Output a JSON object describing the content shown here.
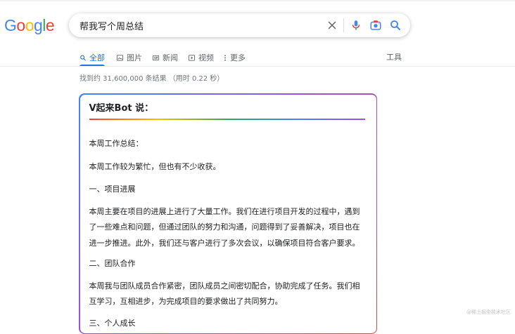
{
  "logo": {
    "letters": [
      "G",
      "o",
      "o",
      "g",
      "l",
      "e"
    ],
    "colors": [
      "#4285F4",
      "#EA4335",
      "#FBBC05",
      "#4285F4",
      "#34A853",
      "#EA4335"
    ]
  },
  "search": {
    "query": "帮我写个周总结"
  },
  "tabs": [
    {
      "label": "全部",
      "icon": "search-icon",
      "active": true
    },
    {
      "label": "图片",
      "icon": "image-icon"
    },
    {
      "label": "新闻",
      "icon": "news-icon"
    },
    {
      "label": "视频",
      "icon": "video-icon"
    },
    {
      "label": "更多",
      "icon": "more-dots-icon"
    }
  ],
  "tools_label": "工具",
  "stats": "找到约 31,600,000 条结果 （用时 0.22 秒）",
  "card": {
    "title": "V起来Bot 说：",
    "paragraphs": [
      "本周工作总结：",
      "本周工作较为繁忙，但也有不少收获。",
      "一、项目进展",
      "本周主要在项目的进展上进行了大量工作。我们在进行项目开发的过程中，遇到了一些难点和问题，但通过团队的努力和沟通，问题得到了妥善解决，项目也在进一步推进。此外，我们还与客户进行了多次会议，以确保项目符合客户要求。",
      "二、团队合作",
      "本周我与团队成员合作紧密，团队成员之间密切配合，协助完成了任务。我们相互学习，互相进步，为完成项目的要求做出了共同努力。",
      "三、个人成长"
    ]
  },
  "watermark": "@稀土掘金技术社区",
  "colors": {
    "accent": "#1a73e8",
    "tab_text": "#5f6368"
  }
}
